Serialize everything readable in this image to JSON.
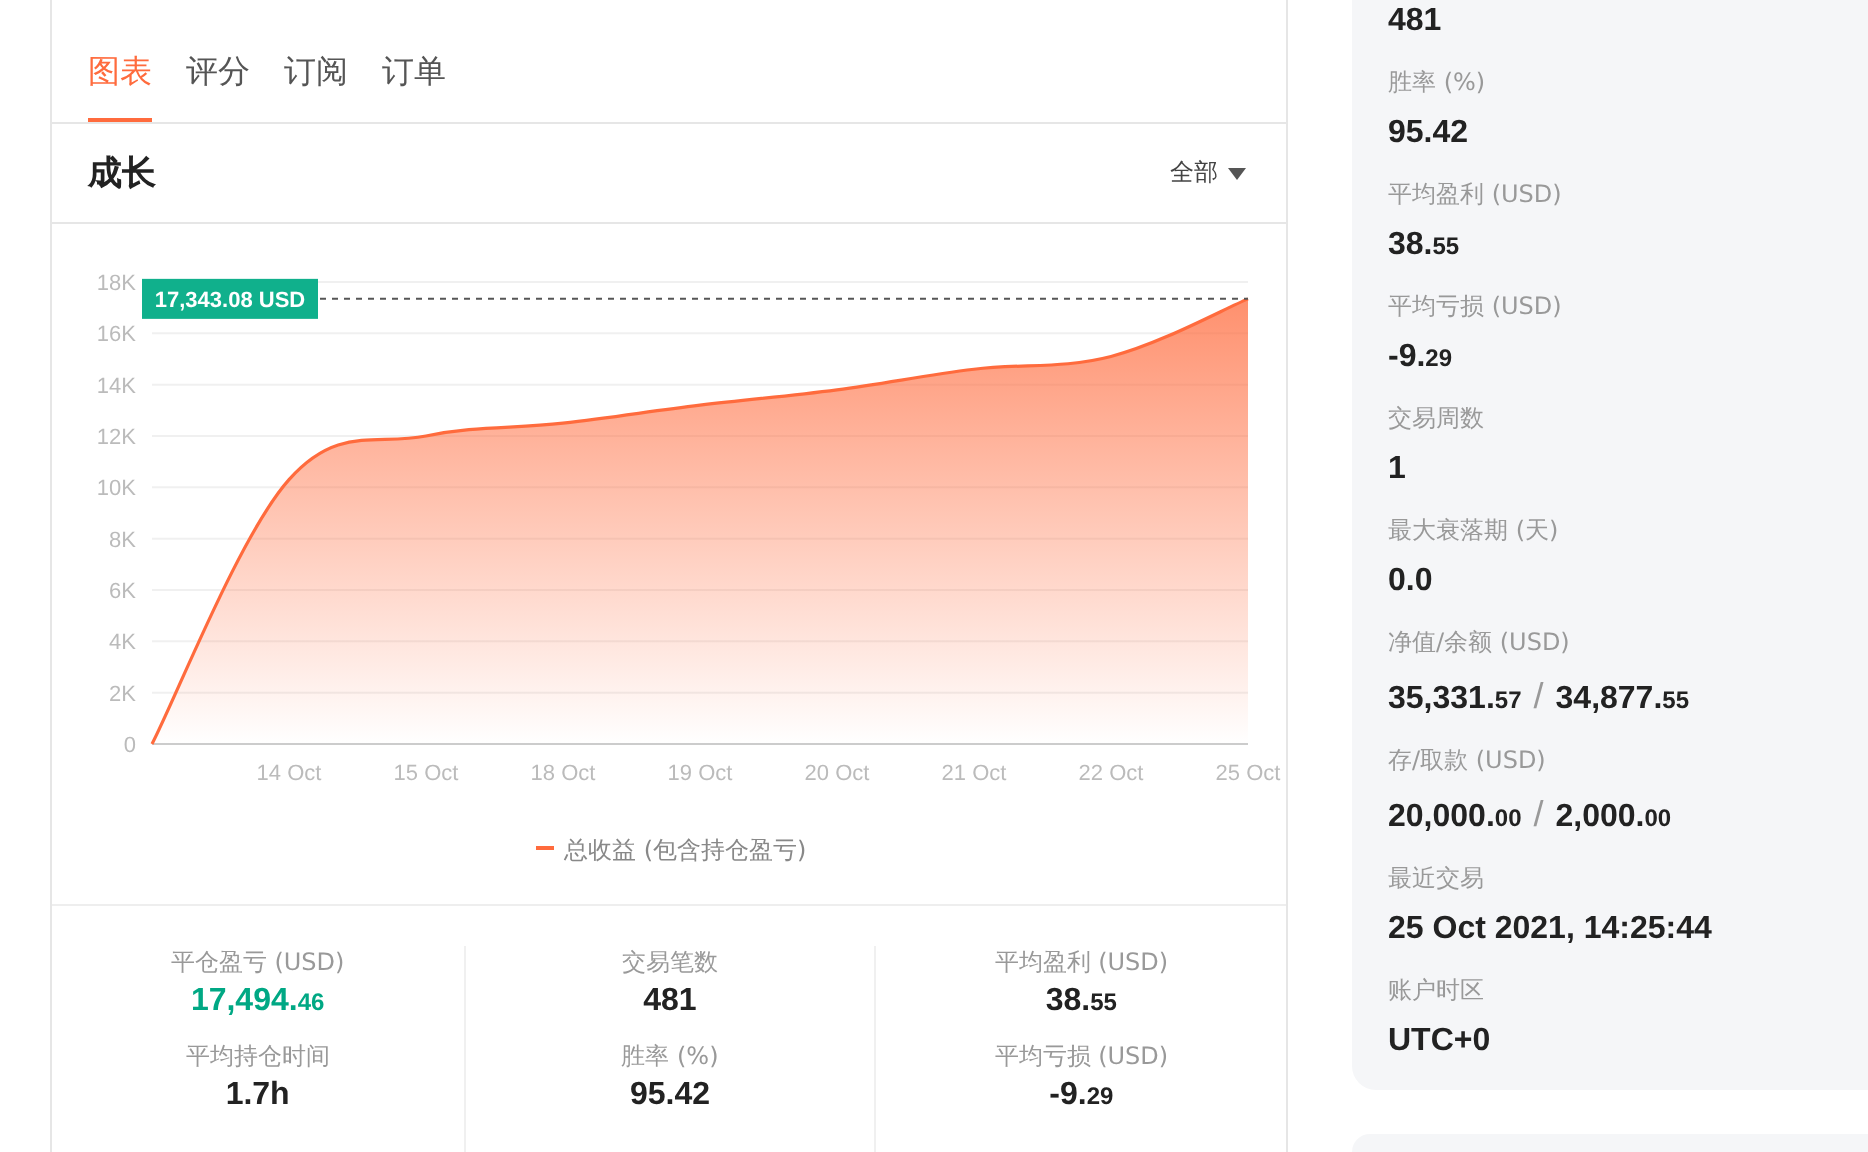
{
  "tabs": [
    {
      "label": "图表",
      "selected": true
    },
    {
      "label": "评分",
      "selected": false
    },
    {
      "label": "订阅",
      "selected": false
    },
    {
      "label": "订单",
      "selected": false
    }
  ],
  "growth": {
    "title": "成长",
    "filter": "全部",
    "chart_data": {
      "type": "area",
      "categories": [
        null,
        "14 Oct",
        "15 Oct",
        "18 Oct",
        "19 Oct",
        "20 Oct",
        "21 Oct",
        "22 Oct",
        "25 Oct"
      ],
      "ylim": [
        0,
        18000
      ],
      "yticks": [
        {
          "value": 0,
          "label": "0"
        },
        {
          "value": 2000,
          "label": "2K"
        },
        {
          "value": 4000,
          "label": "4K"
        },
        {
          "value": 6000,
          "label": "6K"
        },
        {
          "value": 8000,
          "label": "8K"
        },
        {
          "value": 10000,
          "label": "10K"
        },
        {
          "value": 12000,
          "label": "12K"
        },
        {
          "value": 14000,
          "label": "14K"
        },
        {
          "value": 16000,
          "label": "16K"
        },
        {
          "value": 18000,
          "label": "18K"
        }
      ],
      "series": [
        {
          "name": "总收益 (包含持仓盈亏)",
          "color": "#ff6b3d",
          "values": [
            0,
            10300,
            12000,
            12500,
            13200,
            13800,
            14600,
            15100,
            17343.08
          ]
        }
      ],
      "grid": true,
      "ref_lines": [
        {
          "axis": "y",
          "value": 17343.08,
          "label": "17,343.08 USD"
        }
      ]
    }
  },
  "stats": [
    {
      "label": "平仓盈亏 (USD)",
      "color": "#00a884",
      "value": [
        {
          "t": "17,494.",
          "kind": "main"
        },
        {
          "t": "46",
          "kind": "small"
        }
      ]
    },
    {
      "label": "平均持仓时间",
      "color": "#222222",
      "value": [
        {
          "t": "1.7h",
          "kind": "main"
        }
      ]
    },
    {
      "label": "交易笔数",
      "color": "#222222",
      "value": [
        {
          "t": "481",
          "kind": "main"
        }
      ]
    },
    {
      "label": "胜率 (%)",
      "color": "#222222",
      "value": [
        {
          "t": "95.42",
          "kind": "main"
        }
      ]
    },
    {
      "label": "平均盈利 (USD)",
      "color": "#222222",
      "value": [
        {
          "t": "38.",
          "kind": "main"
        },
        {
          "t": "55",
          "kind": "small"
        }
      ]
    },
    {
      "label": "平均亏损 (USD)",
      "color": "#222222",
      "value": [
        {
          "t": "-9.",
          "kind": "main"
        },
        {
          "t": "29",
          "kind": "small"
        }
      ]
    }
  ],
  "details": [
    {
      "value": [
        {
          "t": "481",
          "kind": "main"
        }
      ]
    },
    {
      "label": "胜率 (%)",
      "value": [
        {
          "t": "95.42",
          "kind": "main"
        }
      ]
    },
    {
      "label": "平均盈利 (USD)",
      "value": [
        {
          "t": "38.",
          "kind": "main"
        },
        {
          "t": "55",
          "kind": "small"
        }
      ]
    },
    {
      "label": "平均亏损 (USD)",
      "value": [
        {
          "t": "-9.",
          "kind": "main"
        },
        {
          "t": "29",
          "kind": "small"
        }
      ]
    },
    {
      "label": "交易周数",
      "value": [
        {
          "t": "1",
          "kind": "main"
        }
      ]
    },
    {
      "label": "最大衰落期 (天)",
      "value": [
        {
          "t": "0.0",
          "kind": "main"
        }
      ]
    },
    {
      "label": "净值/余额 (USD)",
      "value": [
        {
          "t": "35,331.",
          "kind": "main"
        },
        {
          "t": "57",
          "kind": "small"
        },
        {
          "t": "/",
          "kind": "sep"
        },
        {
          "t": "34,877.",
          "kind": "main"
        },
        {
          "t": "55",
          "kind": "small"
        }
      ]
    },
    {
      "label": "存/取款 (USD)",
      "value": [
        {
          "t": "20,000.",
          "kind": "main"
        },
        {
          "t": "00",
          "kind": "small"
        },
        {
          "t": "/",
          "kind": "sep"
        },
        {
          "t": "2,000.",
          "kind": "main"
        },
        {
          "t": "00",
          "kind": "small"
        }
      ]
    },
    {
      "label": "最近交易",
      "value": [
        {
          "t": "25 Oct 2021, 14:25:44",
          "kind": "main"
        }
      ]
    },
    {
      "label": "账户时区",
      "value": [
        {
          "t": "UTC+0",
          "kind": "main"
        }
      ]
    }
  ]
}
